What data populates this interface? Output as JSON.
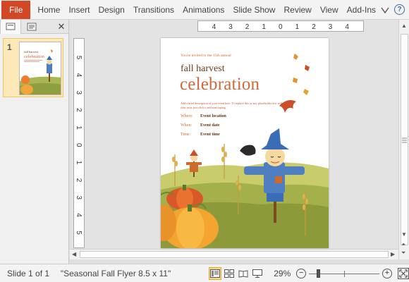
{
  "ribbon": {
    "file_label": "File",
    "tabs": [
      "Home",
      "Insert",
      "Design",
      "Transitions",
      "Animations",
      "Slide Show",
      "Review",
      "View",
      "Add-Ins"
    ],
    "icons": [
      "smiley-icon",
      "help-icon"
    ],
    "help_glyph": "?"
  },
  "left_pane": {
    "close_glyph": "✕",
    "thumbnail_number": "1",
    "thumb_texts": {
      "title1": "fall harvest",
      "title2": "celebration"
    }
  },
  "rulers": {
    "horizontal": [
      "4",
      "3",
      "2",
      "1",
      "0",
      "1",
      "2",
      "3",
      "4"
    ],
    "vertical": [
      "5",
      "4",
      "3",
      "2",
      "1",
      "0",
      "1",
      "2",
      "3",
      "4",
      "5"
    ]
  },
  "slide": {
    "invite": "You're invited to the 15th annual",
    "title_line1": "fall harvest",
    "title_line2": "celebration",
    "description": "Add a brief description of your event here. To replace this or any placeholder text with your own, just click it and start typing.",
    "rows": [
      {
        "label": "Where:",
        "value": "Event location"
      },
      {
        "label": "When:",
        "value": "Event date"
      },
      {
        "label": "Time:",
        "value": "Event time"
      }
    ]
  },
  "status": {
    "slide_text": "Slide 1 of 1",
    "theme_text": "\"Seasonal Fall Flyer 8.5 x 11\"",
    "zoom_text": "29%",
    "zoom_fraction": 0.29,
    "zoom_minus": "−",
    "zoom_plus": "+"
  },
  "colors": {
    "file_tab": "#d24726",
    "accent_orange": "#d2683a",
    "brown": "#6b3a1f",
    "view_active": "#fbd78a"
  }
}
